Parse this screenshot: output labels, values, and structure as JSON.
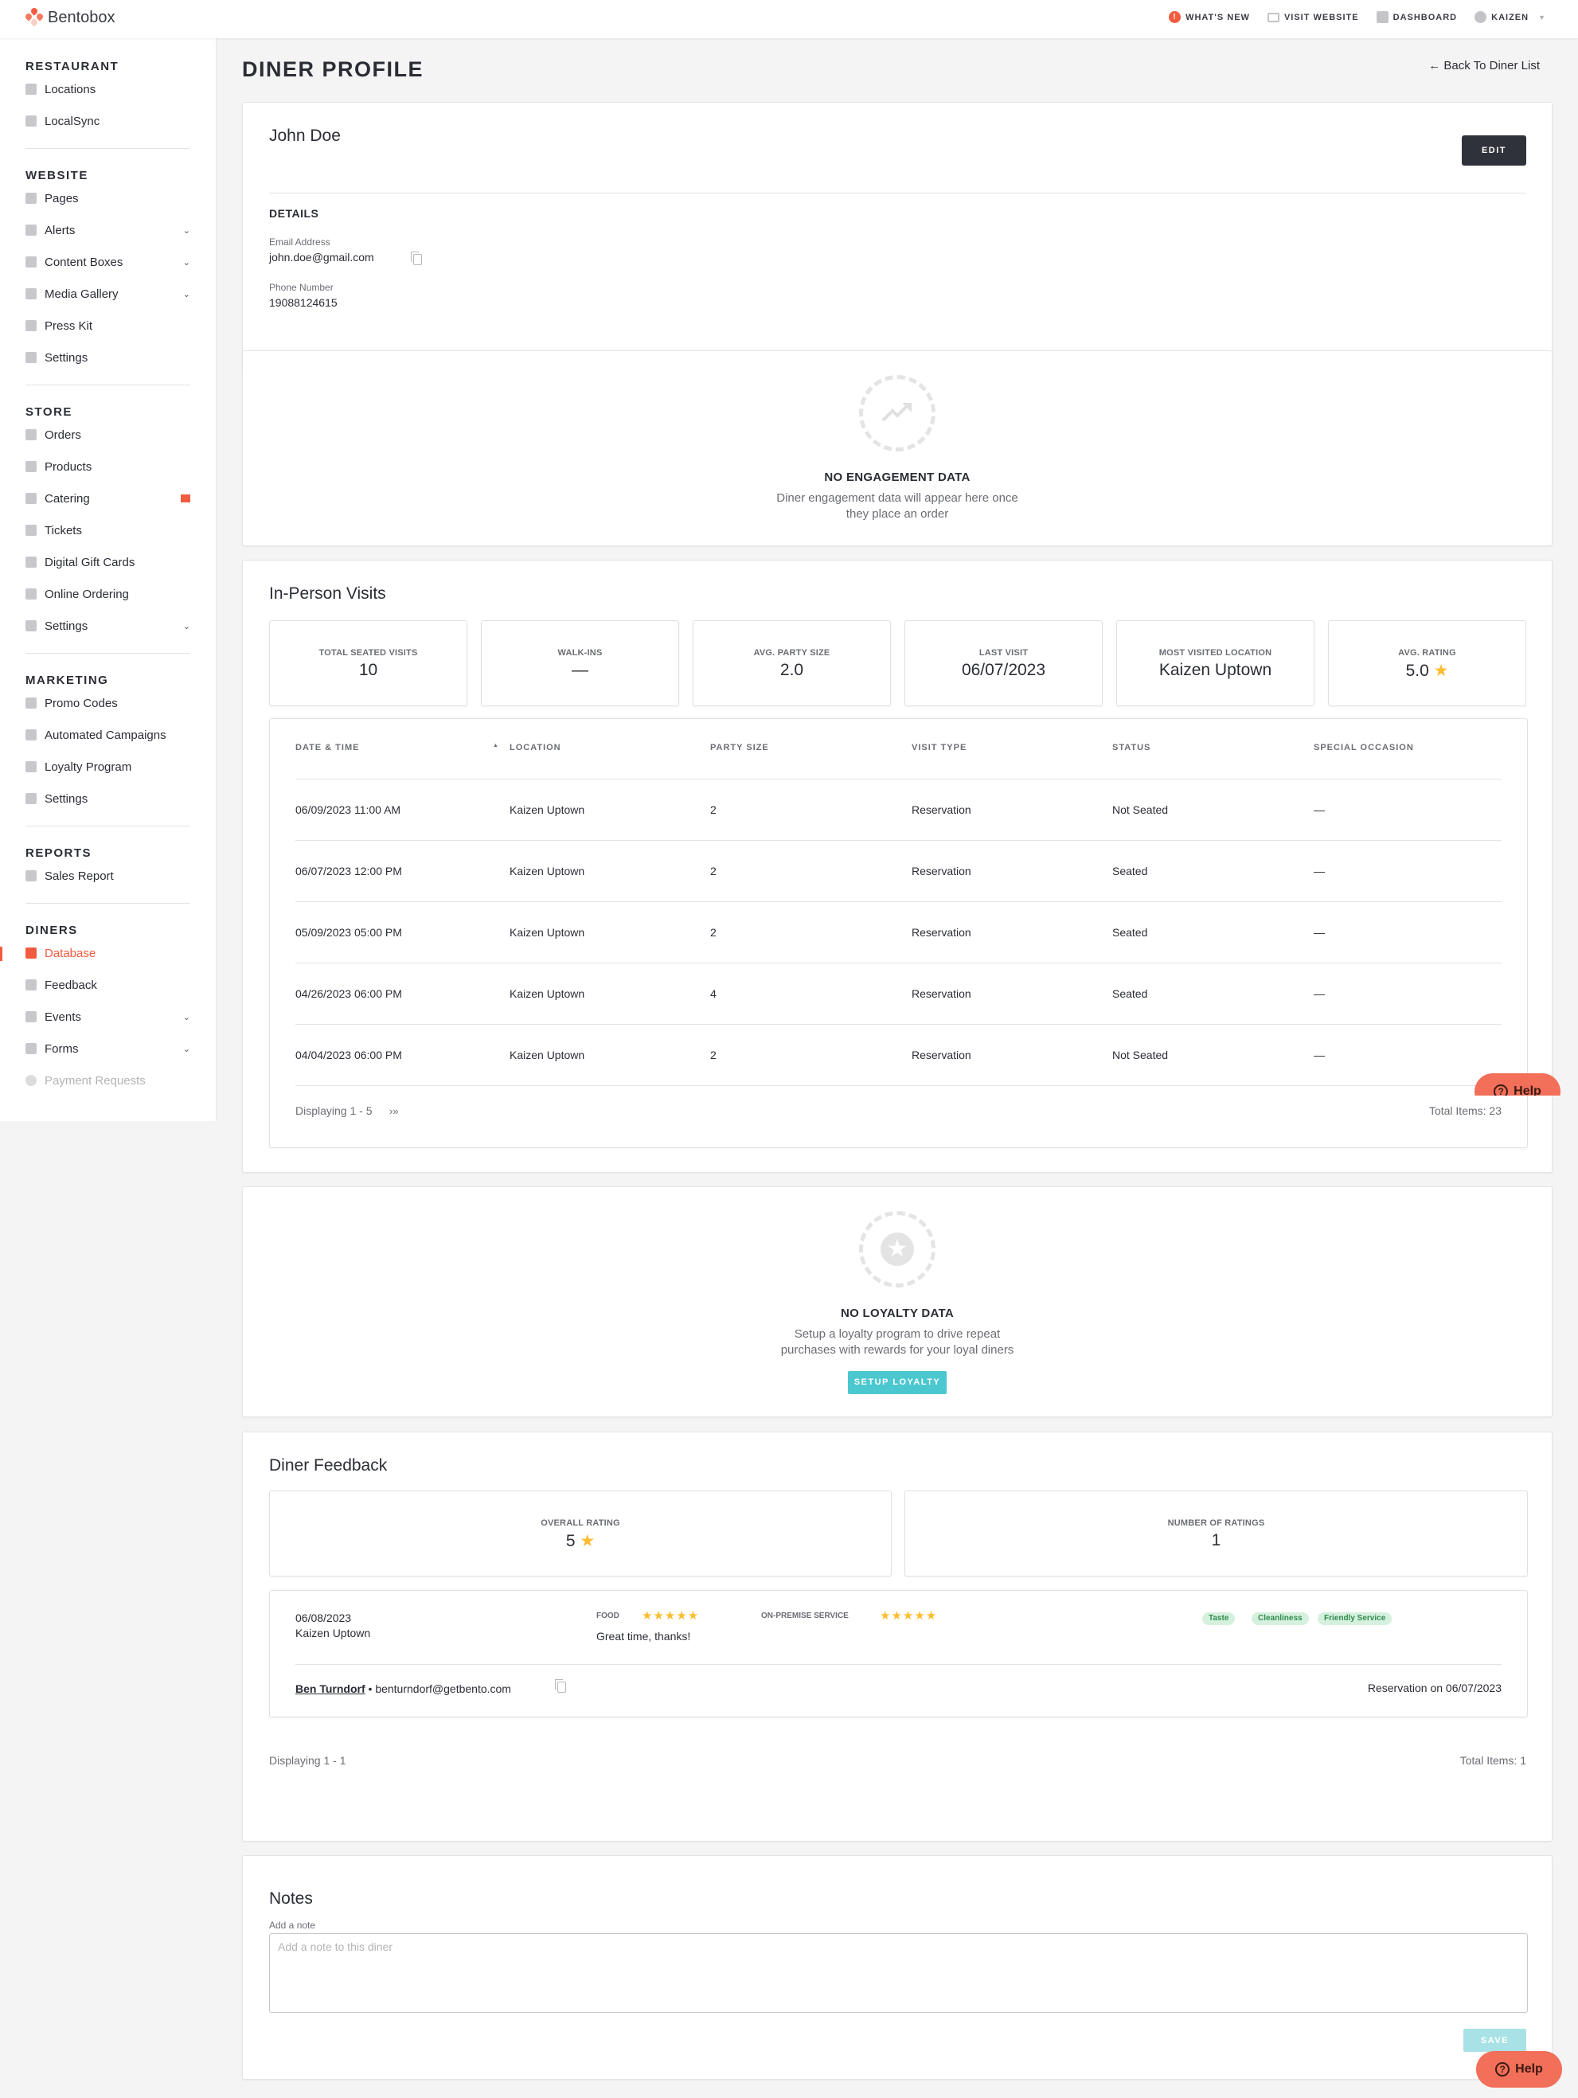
{
  "app": {
    "brand": "Bentobox"
  },
  "topnav": {
    "items": [
      {
        "label": "WHAT'S NEW",
        "icon": "alert-badge-icon"
      },
      {
        "label": "VISIT WEBSITE",
        "icon": "browser-window-icon"
      },
      {
        "label": "DASHBOARD",
        "icon": "bar-chart-icon"
      },
      {
        "label": "KAIZEN",
        "icon": "user-circle-icon"
      }
    ]
  },
  "sidebar": {
    "sections": [
      {
        "heading": "RESTAURANT",
        "items": [
          {
            "label": "Locations",
            "icon": "storefront-icon"
          },
          {
            "label": "LocalSync",
            "icon": "sync-icon"
          }
        ]
      },
      {
        "heading": "WEBSITE",
        "items": [
          {
            "label": "Pages",
            "icon": "page-icon"
          },
          {
            "label": "Alerts",
            "icon": "alert-message-icon",
            "expandable": true
          },
          {
            "label": "Content Boxes",
            "icon": "grid-icon",
            "expandable": true
          },
          {
            "label": "Media Gallery",
            "icon": "gallery-icon",
            "expandable": true
          },
          {
            "label": "Press Kit",
            "icon": "document-icon"
          },
          {
            "label": "Settings",
            "icon": "gear-icon"
          }
        ]
      },
      {
        "heading": "STORE",
        "items": [
          {
            "label": "Orders",
            "icon": "dollar-icon"
          },
          {
            "label": "Products",
            "icon": "cart-icon"
          },
          {
            "label": "Catering",
            "icon": "utensils-icon",
            "flag": true
          },
          {
            "label": "Tickets",
            "icon": "ticket-icon"
          },
          {
            "label": "Digital Gift Cards",
            "icon": "gift-card-icon"
          },
          {
            "label": "Online Ordering",
            "icon": "bag-icon"
          },
          {
            "label": "Settings",
            "icon": "gear-icon",
            "expandable": true
          }
        ]
      },
      {
        "heading": "MARKETING",
        "items": [
          {
            "label": "Promo Codes",
            "icon": "tag-icon"
          },
          {
            "label": "Automated Campaigns",
            "icon": "envelope-icon"
          },
          {
            "label": "Loyalty Program",
            "icon": "star-badge-icon"
          },
          {
            "label": "Settings",
            "icon": "gear-icon"
          }
        ]
      },
      {
        "heading": "REPORTS",
        "items": [
          {
            "label": "Sales Report",
            "icon": "bar-chart-icon"
          }
        ]
      },
      {
        "heading": "DINERS",
        "items": [
          {
            "label": "Database",
            "icon": "cart-icon",
            "active": true
          },
          {
            "label": "Feedback",
            "icon": "feedback-icon"
          },
          {
            "label": "Events",
            "icon": "calendar-icon",
            "expandable": true
          },
          {
            "label": "Forms",
            "icon": "calendar-check-icon",
            "expandable": true
          },
          {
            "label": "Payment Requests",
            "icon": "dollar-icon",
            "disabled": true
          }
        ]
      }
    ]
  },
  "page": {
    "title": "DINER PROFILE",
    "back_link": "← Back To Diner List"
  },
  "profile": {
    "name": "John Doe",
    "edit_label": "EDIT",
    "details_title": "DETAILS",
    "email_label": "Email Address",
    "email": "john.doe@gmail.com",
    "phone_label": "Phone Number",
    "phone": "19088124615"
  },
  "engagement": {
    "title": "NO ENGAGEMENT DATA",
    "description_line1": "Diner engagement data will appear here once",
    "description_line2": "they place an order"
  },
  "visits": {
    "title": "In-Person Visits",
    "stats": [
      {
        "label": "TOTAL SEATED VISITS",
        "value": "10"
      },
      {
        "label": "WALK-INS",
        "value": "—"
      },
      {
        "label": "AVG. PARTY SIZE",
        "value": "2.0"
      },
      {
        "label": "LAST VISIT",
        "value": "06/07/2023"
      },
      {
        "label": "MOST VISITED LOCATION",
        "value": "Kaizen Uptown"
      },
      {
        "label": "AVG. RATING",
        "value": "5.0",
        "star": "★"
      }
    ],
    "columns": [
      "DATE & TIME",
      "LOCATION",
      "PARTY SIZE",
      "VISIT TYPE",
      "STATUS",
      "SPECIAL OCCASION"
    ],
    "sort_indicator": "▲",
    "rows": [
      {
        "datetime": "06/09/2023 11:00 AM",
        "location": "Kaizen Uptown",
        "party_size": "2",
        "visit_type": "Reservation",
        "status": "Not Seated",
        "occasion": "—"
      },
      {
        "datetime": "06/07/2023 12:00 PM",
        "location": "Kaizen Uptown",
        "party_size": "2",
        "visit_type": "Reservation",
        "status": "Seated",
        "occasion": "—"
      },
      {
        "datetime": "05/09/2023 05:00 PM",
        "location": "Kaizen Uptown",
        "party_size": "2",
        "visit_type": "Reservation",
        "status": "Seated",
        "occasion": "—"
      },
      {
        "datetime": "04/26/2023 06:00 PM",
        "location": "Kaizen Uptown",
        "party_size": "4",
        "visit_type": "Reservation",
        "status": "Seated",
        "occasion": "—"
      },
      {
        "datetime": "04/04/2023 06:00 PM",
        "location": "Kaizen Uptown",
        "party_size": "2",
        "visit_type": "Reservation",
        "status": "Not Seated",
        "occasion": "—"
      }
    ],
    "displaying": "Displaying 1 - 5",
    "pager_next": "›»",
    "total": "Total Items: 23"
  },
  "loyalty": {
    "title": "NO LOYALTY DATA",
    "description_line1": "Setup a loyalty program to drive repeat",
    "description_line2": "purchases with rewards for your loyal diners",
    "button": "SETUP LOYALTY"
  },
  "feedback": {
    "title": "Diner Feedback",
    "stats": [
      {
        "label": "OVERALL RATING",
        "value": "5",
        "star": "★"
      },
      {
        "label": "NUMBER OF RATINGS",
        "value": "1"
      }
    ],
    "entries": [
      {
        "date": "06/08/2023",
        "location": "Kaizen Uptown",
        "food_label": "FOOD",
        "food_rating": 5,
        "food_stars": "★★★★★",
        "service_label": "ON-PREMISE SERVICE",
        "service_rating": 5,
        "service_stars": "★★★★★",
        "comment": "Great time, thanks!",
        "tags": [
          "Taste",
          "Cleanliness",
          "Friendly Service"
        ],
        "reviewer": "Ben Turndorf",
        "separator": "•",
        "reviewer_email": "benturndorf@getbento.com",
        "reservation": "Reservation on 06/07/2023"
      }
    ],
    "displaying": "Displaying 1 - 1",
    "total": "Total Items: 1"
  },
  "notes": {
    "title": "Notes",
    "label": "Add a note",
    "placeholder": "Add a note to this diner",
    "value": "",
    "save": "SAVE"
  },
  "help": {
    "label": "Help",
    "icon_glyph": "?"
  },
  "colors": {
    "accent": "#f25b3f",
    "teal": "#4bc7cf",
    "star": "#fbbd2e",
    "tag_bg": "#d5f1de",
    "tag_text": "#2f8a4e",
    "dark_button": "#30323b"
  }
}
